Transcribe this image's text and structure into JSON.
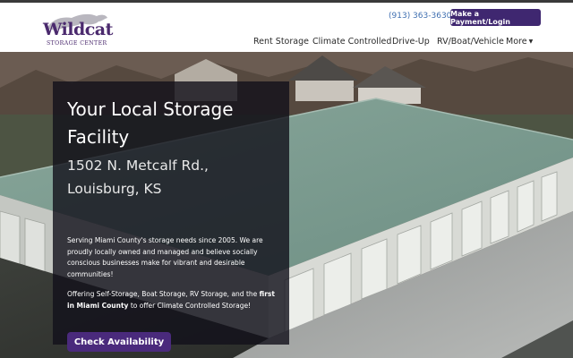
{
  "header": {
    "logo_name": "Wildcat",
    "logo_subtitle": "STORAGE CENTER",
    "phone": "(913) 363-3630",
    "payment_button": "Make a Payment/Login"
  },
  "nav": {
    "items": [
      {
        "label": "Rent Storage"
      },
      {
        "label": "Climate Controlled"
      },
      {
        "label": "Drive-Up"
      },
      {
        "label": "RV/Boat/Vehicle"
      },
      {
        "label": "More"
      }
    ]
  },
  "hero": {
    "title": "Your Local Storage Facility",
    "address": "1502 N. Metcalf Rd., Louisburg, KS",
    "paragraph1": "Serving Miami County's storage needs since 2005. We are proudly locally owned and managed and believe socially conscious businesses make for vibrant and desirable communities!",
    "paragraph2_before": "Offering Self-Storage, Boat Storage, RV Storage, and the ",
    "paragraph2_bold": "first in Miami County",
    "paragraph2_after": " to offer Climate Controlled Storage!",
    "cta": "Check Availability"
  },
  "colors": {
    "brand_purple": "#3f2770",
    "link_blue": "#3f6fb1"
  },
  "icons": {
    "logo_mark": "wildcat-icon",
    "more_caret": "caret-down-icon"
  }
}
